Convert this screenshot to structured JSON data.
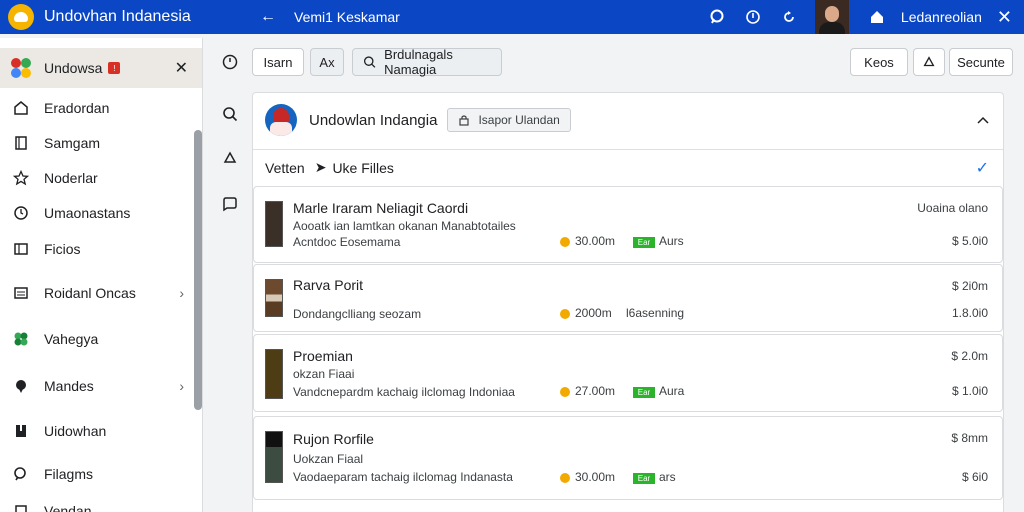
{
  "topbar": {
    "app_title": "Undovhan Indanesia",
    "back_icon": "arrow-left-icon",
    "window_title": "Vemi1 Keskamar",
    "user_name": "Ledanreolian",
    "colors": {
      "background": "#0b47c4",
      "logo": "#f4b400"
    }
  },
  "sidebar": {
    "header_label": "Undowsa",
    "items": [
      {
        "label": "Eradordan",
        "icon": "home-icon"
      },
      {
        "label": "Samgam",
        "icon": "book-icon"
      },
      {
        "label": "Noderlar",
        "icon": "star-icon"
      },
      {
        "label": "Umaonastans",
        "icon": "clock-icon"
      },
      {
        "label": "Ficios",
        "icon": "folder-icon"
      },
      {
        "label": "Roidanl Oncas",
        "icon": "list-icon"
      },
      {
        "label": "Vahegya",
        "icon": "leaf-icon"
      },
      {
        "label": "Mandes",
        "icon": "pin-icon"
      },
      {
        "label": "Uidowhan",
        "icon": "bookmark-icon"
      },
      {
        "label": "Filagms",
        "icon": "search-icon"
      },
      {
        "label": "Vendan",
        "icon": "tag-icon"
      }
    ]
  },
  "toolbar": {
    "btn1": "Isarn",
    "btn2": "Ax",
    "search": "Brdulnagals Namagia",
    "btn_right1": "Keos",
    "btn_right2": "Secunte"
  },
  "panel": {
    "title": "Undowlan Indangia",
    "chip": "Isapor Ulandan",
    "path_root": "Vetten",
    "path_leaf": "Uke Filles",
    "rows": [
      {
        "title": "Marle Iraram Neliagit Caordi",
        "subtitle": "Aooatk ian lamtkan okanan Manabtotailes",
        "meta": "Acntdoc Eosemama",
        "right_top": "Uoaina olano",
        "duration": "30.00m",
        "tag": "Ear",
        "tag_label": "Aurs",
        "price": "$ 5.0i0"
      },
      {
        "title": "Rarva Porit",
        "subtitle": "Dondangclliang seozam",
        "right_top": "$ 2i0m",
        "duration": "2000m",
        "tag_label": "l6asenning",
        "price": "1.8.0i0"
      },
      {
        "title": "Proemian",
        "subtitle": "okzan Fiaai",
        "meta": "Vandcnepardm kachaig ilclomag Indoniaa",
        "right_top": "$ 2.0m",
        "duration": "27.00m",
        "tag": "Ear",
        "tag_label": "Aura",
        "price": "$ 1.0i0"
      },
      {
        "title": "Rujon Rorfile",
        "subtitle": "Uokzan Fiaal",
        "meta": "Vaodaeparam tachaig ilclomag Indanasta",
        "right_top": "$ 8mm",
        "duration": "30.00m",
        "tag": "Ear",
        "tag_label": "ars",
        "price": "$ 6i0"
      }
    ]
  }
}
